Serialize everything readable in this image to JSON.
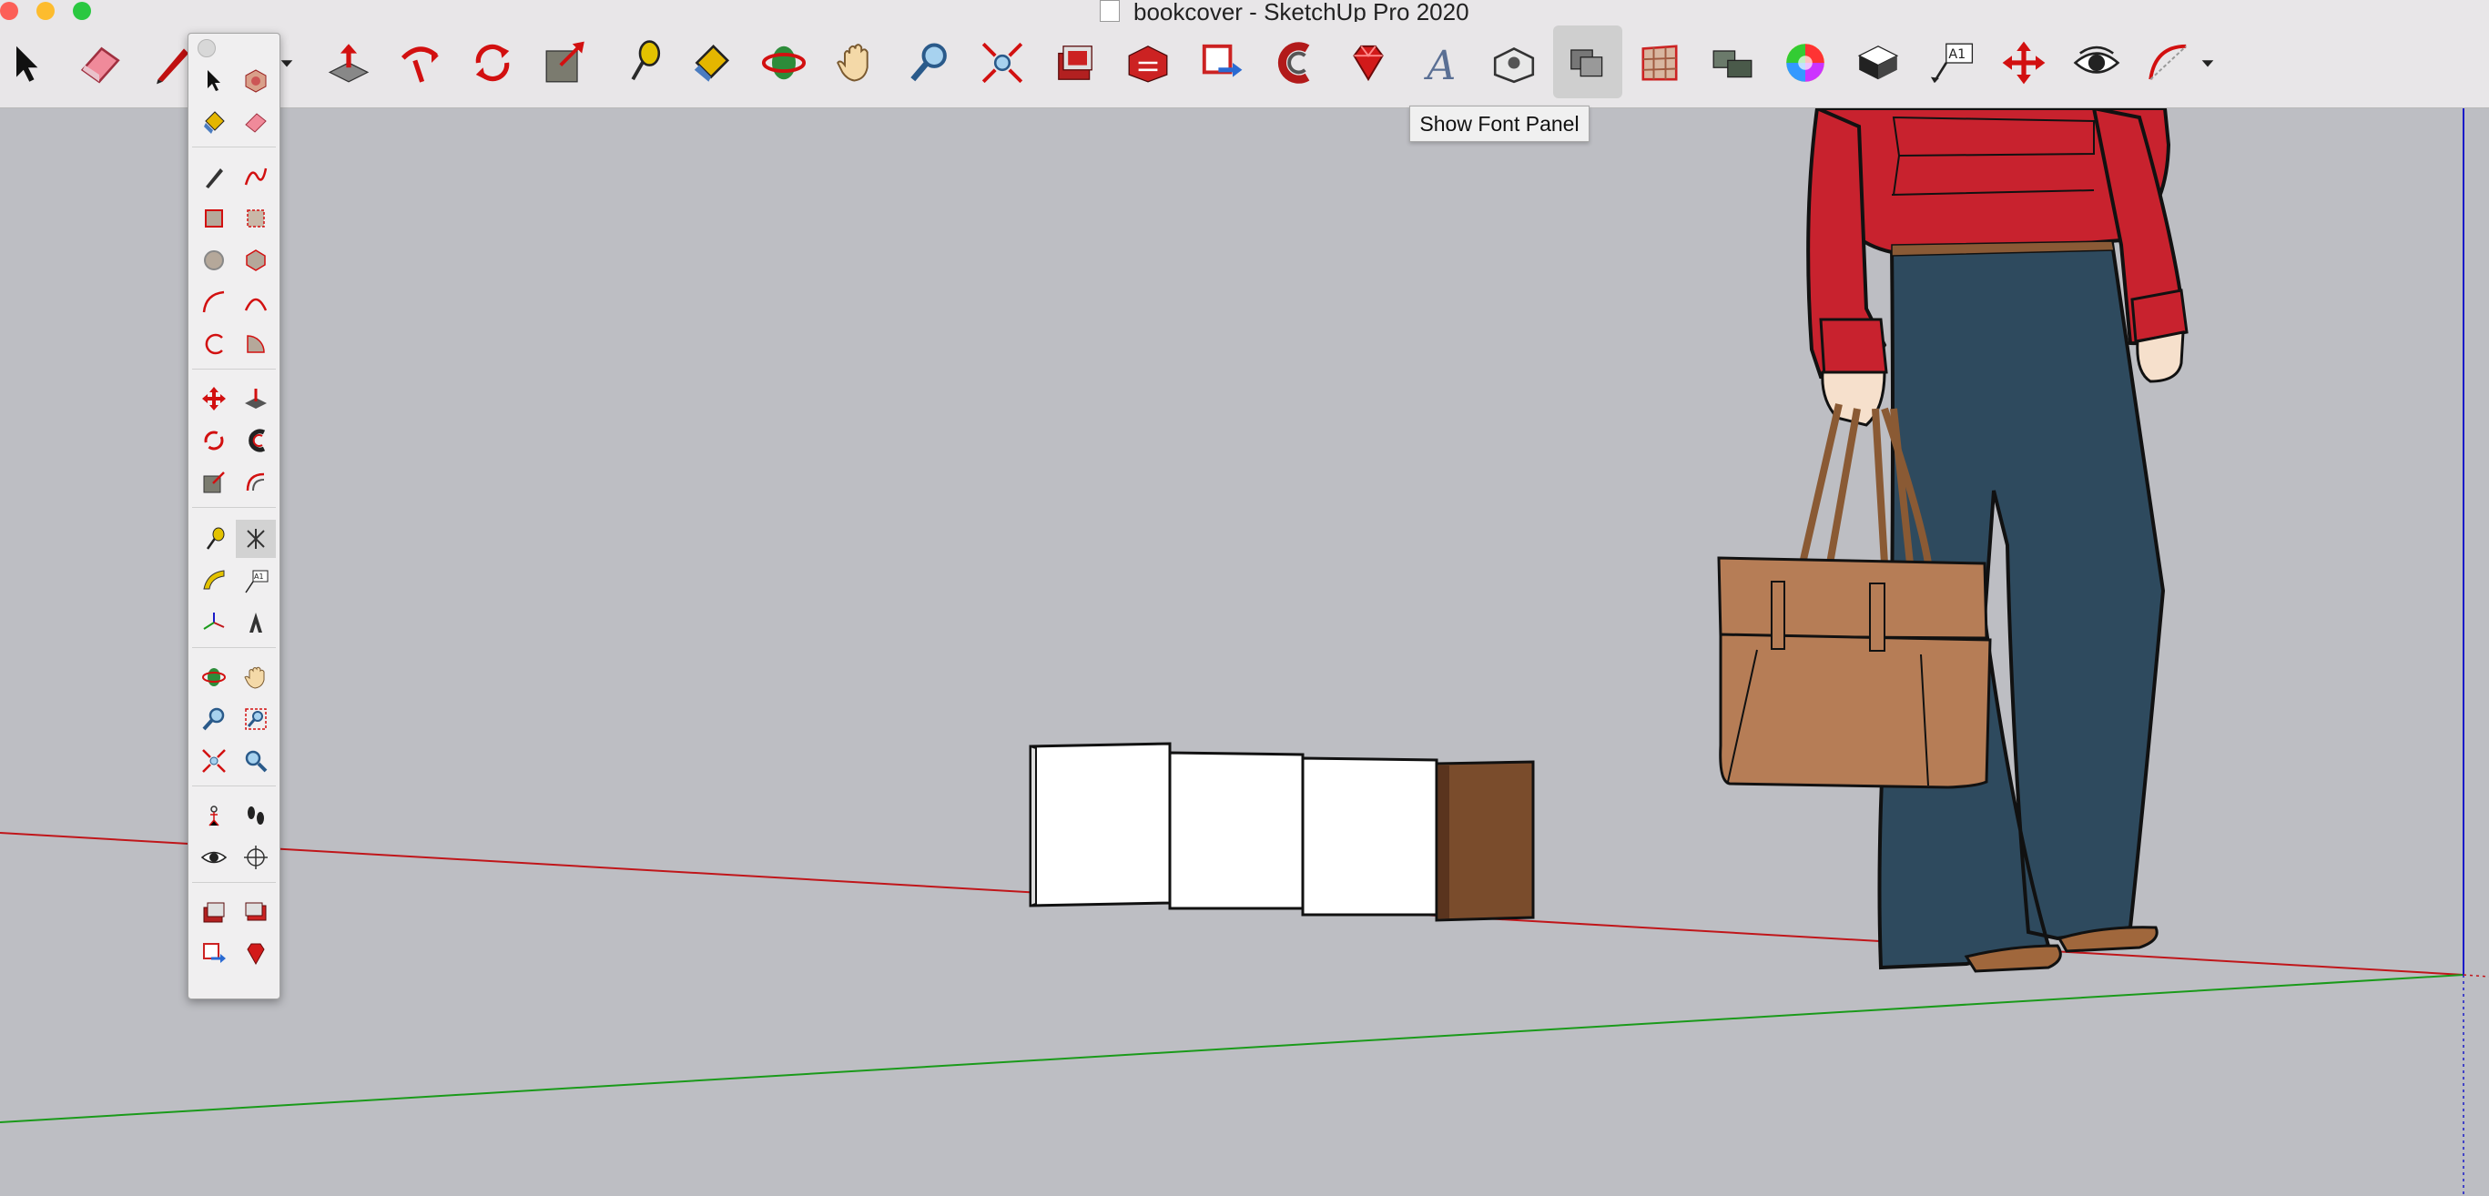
{
  "window": {
    "title": "bookcover - SketchUp Pro 2020",
    "file_icon": "skp-file-icon"
  },
  "toolbar": {
    "tools": [
      {
        "name": "select-tool",
        "icon": "arrow-icon"
      },
      {
        "name": "eraser-tool",
        "icon": "eraser-icon"
      },
      {
        "name": "line-tool",
        "icon": "pencil-icon"
      },
      {
        "name": "push-pull-tool",
        "icon": "push-pull-icon"
      },
      {
        "name": "follow-me-tool",
        "icon": "follow-me-icon"
      },
      {
        "name": "rotate-tool",
        "icon": "rotate-icon"
      },
      {
        "name": "scale-tool",
        "icon": "scale-icon"
      },
      {
        "name": "tape-measure-tool",
        "icon": "tape-measure-icon"
      },
      {
        "name": "paint-bucket-tool",
        "icon": "paint-bucket-icon"
      },
      {
        "name": "orbit-tool",
        "icon": "orbit-icon"
      },
      {
        "name": "pan-tool",
        "icon": "hand-icon"
      },
      {
        "name": "zoom-tool",
        "icon": "magnifier-icon"
      },
      {
        "name": "zoom-extents-tool",
        "icon": "zoom-extents-icon"
      },
      {
        "name": "warehouse-tool",
        "icon": "warehouse-icon"
      },
      {
        "name": "extension-warehouse-tool",
        "icon": "extension-warehouse-icon"
      },
      {
        "name": "send-to-layout-tool",
        "icon": "send-to-layout-icon"
      },
      {
        "name": "offset-tool",
        "icon": "offset-icon"
      },
      {
        "name": "ruby-tool",
        "icon": "ruby-icon"
      },
      {
        "name": "text-style-tool",
        "icon": "font-a-icon"
      },
      {
        "name": "view-iso-tool",
        "icon": "view-iso-icon"
      },
      {
        "name": "shadows-tool",
        "icon": "shadows-icon"
      },
      {
        "name": "section-plane-tool",
        "icon": "section-grid-icon"
      },
      {
        "name": "outliner-tool",
        "icon": "outliner-icon"
      },
      {
        "name": "colors-tool",
        "icon": "color-wheel-icon"
      },
      {
        "name": "styles-tool",
        "icon": "style-box-icon"
      },
      {
        "name": "text-tool",
        "icon": "text-label-icon"
      },
      {
        "name": "move-tool",
        "icon": "move-icon"
      },
      {
        "name": "look-around-tool",
        "icon": "eye-icon"
      },
      {
        "name": "arc-tool",
        "icon": "arc-icon"
      }
    ],
    "tooltip": "Show Font Panel",
    "text_label_glyph": "A1",
    "font_glyph": "A"
  },
  "palette": {
    "rows": 22,
    "text_label_glyph": "A1"
  },
  "scene": {
    "axis_red": "#c0161a",
    "axis_green": "#1a9a1a",
    "axis_blue": "#1a1ac8",
    "sky_color": "#bdbec3",
    "shirt_color": "#c8222e",
    "jeans_color": "#2e4a5e",
    "bag_color": "#b67d56",
    "book_brown": "#7a4c2c"
  }
}
